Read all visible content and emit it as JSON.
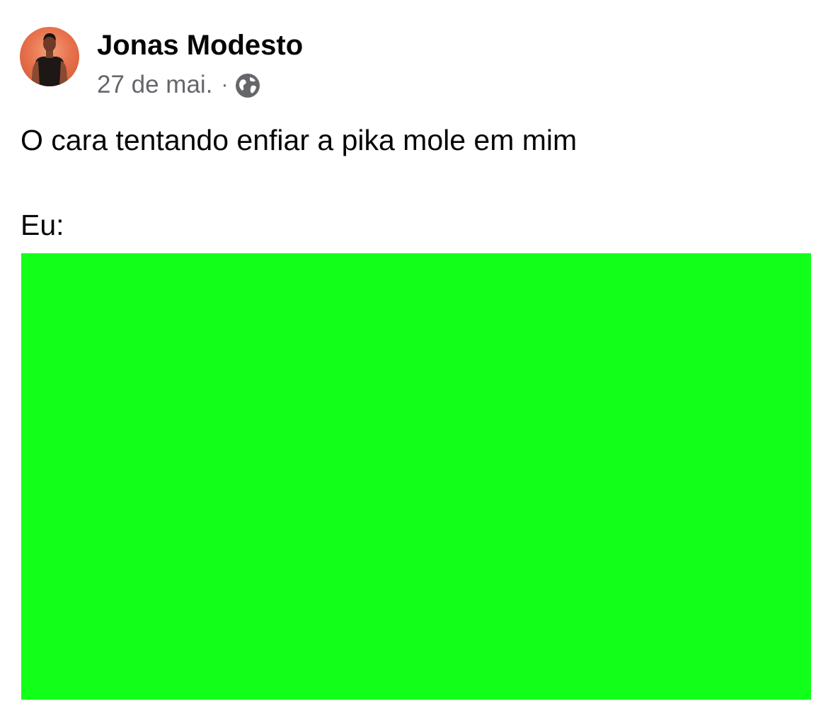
{
  "post": {
    "author_name": "Jonas Modesto",
    "date": "27 de mai.",
    "separator": "·",
    "audience_icon": "globe-icon",
    "text_line_1": "O cara tentando enfiar a pika mole em mim",
    "text_line_2": "Eu:",
    "media_color": "#12ff1a"
  },
  "colors": {
    "text_primary": "#050505",
    "text_secondary": "#65676b",
    "background": "#ffffff"
  }
}
